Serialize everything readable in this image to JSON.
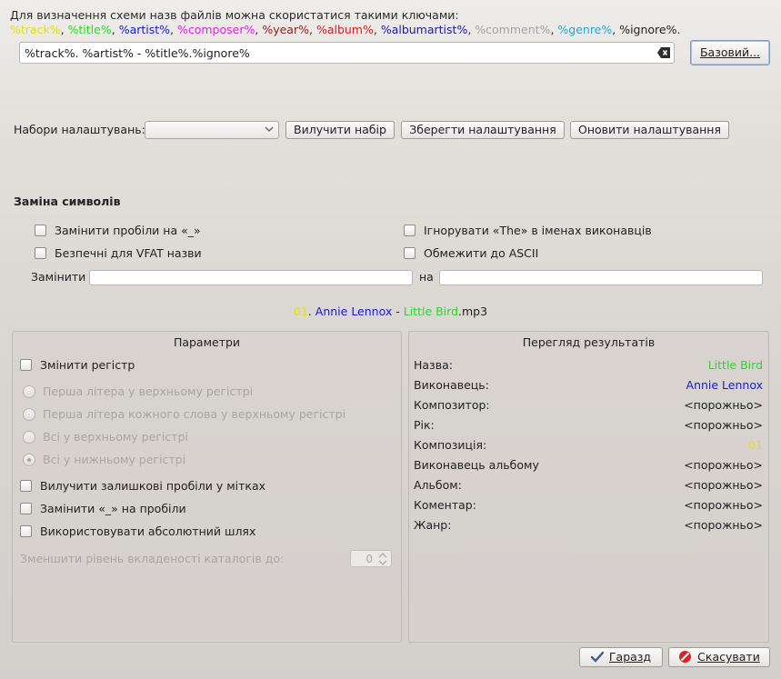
{
  "hint": {
    "text": "Для визначення схеми назв файлів можна скористатися такими ключами:",
    "keys": [
      {
        "label": "%track%",
        "color": "#e5df16"
      },
      {
        "label": "%title%",
        "color": "#2fd42f"
      },
      {
        "label": "%artist%",
        "color": "#1a1acf"
      },
      {
        "label": "%composer%",
        "color": "#e01fe0"
      },
      {
        "label": "%year%",
        "color": "#8c2121"
      },
      {
        "label": "%album%",
        "color": "#d41c1c"
      },
      {
        "label": "%albumartist%",
        "color": "#1a1a9e"
      },
      {
        "label": "%comment%",
        "color": "#a4a4a4"
      },
      {
        "label": "%genre%",
        "color": "#2aa7d8"
      },
      {
        "label": "%ignore%",
        "color": "#222222"
      }
    ]
  },
  "scheme": {
    "value": "%track%. %artist% - %title%.%ignore%"
  },
  "basic_button": "Базовий...",
  "presets": {
    "label": "Набори налаштувань:",
    "selected": "",
    "remove": "Вилучити набір",
    "save": "Зберегти налаштування",
    "update": "Оновити налаштування"
  },
  "char_replace": {
    "title": "Заміна символів",
    "spaces_to_underscore": "Замінити пробіли на «_»",
    "ignore_the": "Ігнорувати «The» в іменах виконавців",
    "vfat_safe": "Безпечні для VFAT назви",
    "ascii_only": "Обмежити до ASCII",
    "replace_label": "Замінити",
    "with_label": "на",
    "replace_from": "",
    "replace_to": ""
  },
  "preview": {
    "track": "01",
    "track_color": "#e5df16",
    "sep1": ". ",
    "artist": "Annie Lennox",
    "artist_color": "#1a1acf",
    "sep2": " - ",
    "title": "Little Bird",
    "title_color": "#2fd42f",
    "ext": ".mp3"
  },
  "options": {
    "title": "Параметри",
    "change_case": "Змінити регістр",
    "case_first_letter": "Перша літера у верхньому регістрі",
    "case_each_word": "Перша літера кожного слова у верхньому регістрі",
    "case_upper": "Всі у верхньому регістрі",
    "case_lower": "Всі у нижньому регістрі",
    "remove_trailing": "Вилучити залишкові пробіли у мітках",
    "underscore_to_space": "Замінити «_» на пробіли",
    "absolute_path": "Використовувати абсолютний шлях",
    "reduce_depth_label": "Зменшити рівень вкладеності каталогів до:",
    "reduce_depth_value": "0"
  },
  "results": {
    "title": "Перегляд результатів",
    "rows": [
      {
        "key": "Назва:",
        "value": "Little Bird",
        "color": "#2fd42f"
      },
      {
        "key": "Виконавець:",
        "value": "Annie Lennox",
        "color": "#1a1acf"
      },
      {
        "key": "Композитор:",
        "value": "<порожньо>",
        "color": "#222222"
      },
      {
        "key": "Рік:",
        "value": "<порожньо>",
        "color": "#222222"
      },
      {
        "key": "Композиція:",
        "value": "01",
        "color": "#e5df16"
      },
      {
        "key": "Виконавець альбому",
        "value": "<порожньо>",
        "color": "#222222"
      },
      {
        "key": "Альбом:",
        "value": "<порожньо>",
        "color": "#222222"
      },
      {
        "key": "Коментар:",
        "value": "<порожньо>",
        "color": "#222222"
      },
      {
        "key": "Жанр:",
        "value": "<порожньо>",
        "color": "#222222"
      }
    ]
  },
  "footer": {
    "ok": "Гаразд",
    "cancel": "Скасувати"
  }
}
